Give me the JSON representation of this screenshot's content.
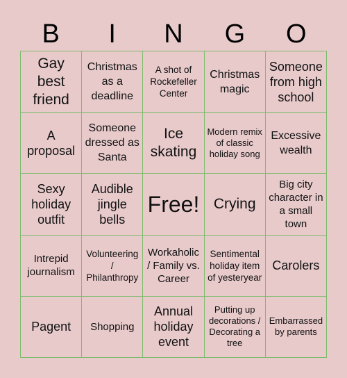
{
  "card": {
    "header_letters": [
      "B",
      "I",
      "N",
      "G",
      "O"
    ],
    "colors": {
      "background": "#e8cacb",
      "grid_line": "#7dbb6d",
      "text": "#111111"
    },
    "rows": [
      [
        "Gay best friend",
        "Christmas as a deadline",
        "A shot of Rockefeller Center",
        "Christmas magic",
        "Someone from high school"
      ],
      [
        "A proposal",
        "Someone dressed as Santa",
        "Ice skating",
        "Modern remix of classic holiday song",
        "Excessive wealth"
      ],
      [
        "Sexy holiday outfit",
        "Audible jingle bells",
        "Free!",
        "Crying",
        "Big city character in a small town"
      ],
      [
        "Intrepid journalism",
        "Volunteering / Philanthropy",
        "Workaholic / Family vs. Career",
        "Sentimental holiday item of yesteryear",
        "Carolers"
      ],
      [
        "Pagent",
        "Shopping",
        "Annual holiday event",
        "Putting up decorations / Decorating a tree",
        "Embarrassed by parents"
      ]
    ]
  }
}
